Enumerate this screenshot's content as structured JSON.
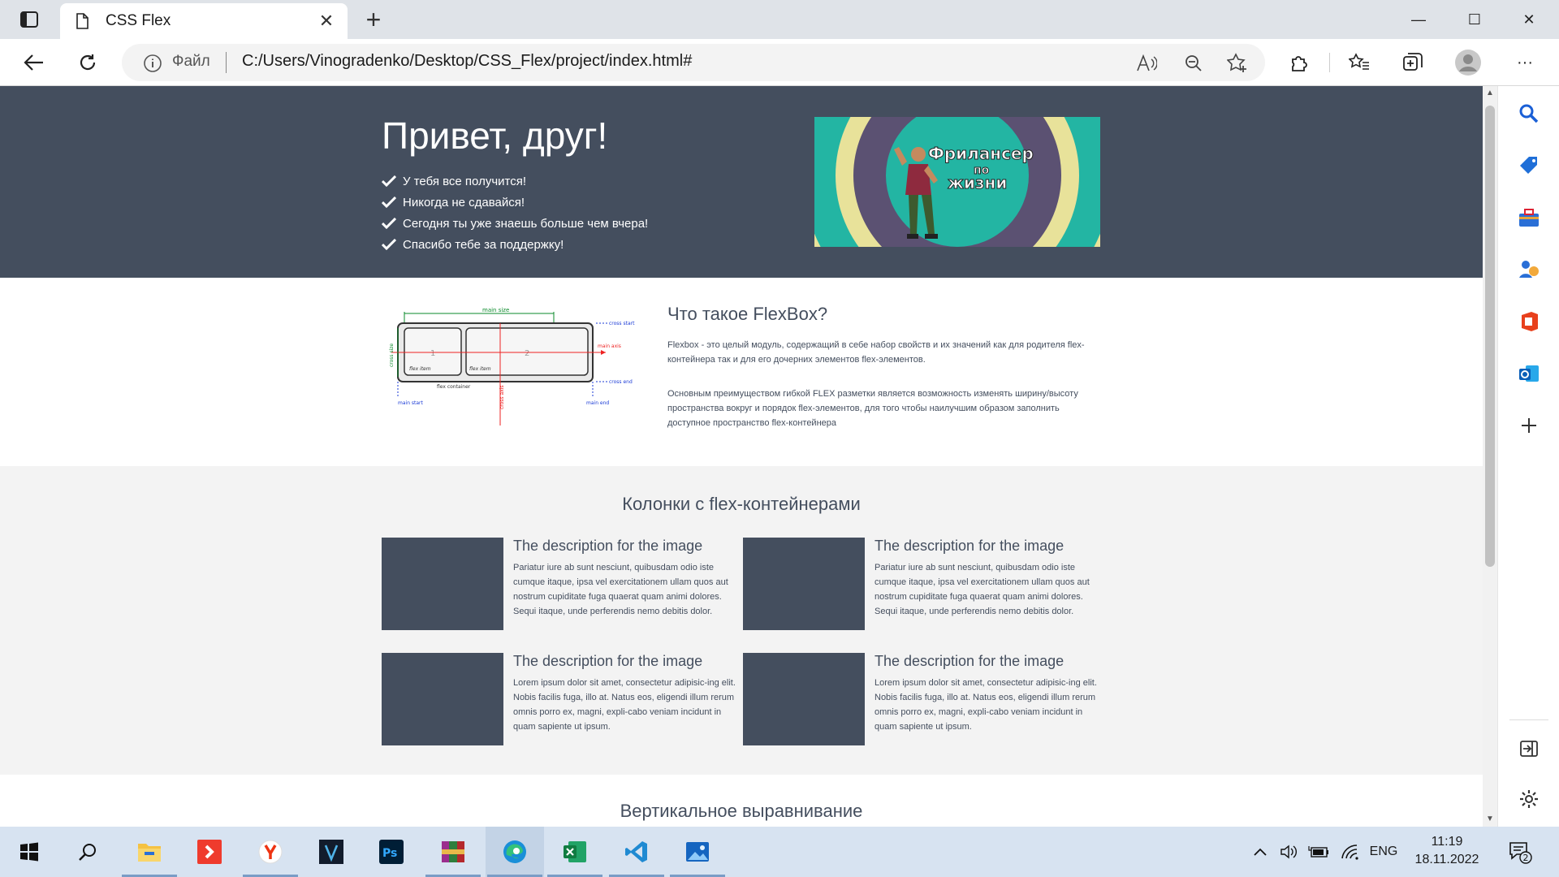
{
  "browser": {
    "tab_title": "CSS Flex",
    "tab_close": "✕",
    "new_tab": "+",
    "address": {
      "file_label": "Файл",
      "url": "C:/Users/Vinogradenko/Desktop/CSS_Flex/project/index.html#"
    },
    "window_controls": [
      "—",
      "☐",
      "✕"
    ],
    "menu": "···"
  },
  "page": {
    "hero": {
      "title": "Привет, друг!",
      "items": [
        "У тебя все получится!",
        "Никогда не сдавайся!",
        "Сегодня ты уже знаешь больше чем вчера!",
        "Спасибо тебе за поддержку!"
      ],
      "banner_text": [
        "Фрилансер",
        "по",
        "жизни"
      ]
    },
    "about": {
      "diagram_labels": {
        "main_size": "main size",
        "cross_start": "cross start",
        "main_axis": "main axis",
        "cross_end": "cross end",
        "cross_size": "cross size",
        "cross_axis": "cross axis",
        "flex_item": "flex item",
        "flex_container": "flex container",
        "main_start": "main start",
        "main_end": "main end",
        "n1": "1",
        "n2": "2"
      },
      "title": "Что такое FlexBox?",
      "p1": "Flexbox - это целый модуль, содержащий в себе набор свойств и их значений как для родителя flex-контейнера так и для его дочерних элементов flex-элементов.",
      "p2": "Основным преимуществом гибкой FLEX разметки является возможность изменять ширину/высоту пространства вокруг и порядок flex-элементов, для того чтобы наилучшим образом заполнить доступное пространство flex-контейнера"
    },
    "columns": {
      "title": "Колонки с flex-контейнерами",
      "cards": [
        {
          "title": "The description for the image",
          "text": "Pariatur iure ab sunt nesciunt, quibusdam odio iste cumque itaque, ipsa vel exercitationem ullam quos aut nostrum cupiditate fuga quaerat quam animi dolores. Sequi itaque, unde perferendis nemo debitis dolor."
        },
        {
          "title": "The description for the image",
          "text": "Pariatur iure ab sunt nesciunt, quibusdam odio iste cumque itaque, ipsa vel exercitationem ullam quos aut nostrum cupiditate fuga quaerat quam animi dolores. Sequi itaque, unde perferendis nemo debitis dolor."
        },
        {
          "title": "The description for the image",
          "text": "Lorem ipsum dolor sit amet, consectetur adipisic-ing elit. Nobis facilis fuga, illo at. Natus eos, eligendi illum rerum omnis porro ex, magni, expli-cabo veniam incidunt in quam sapiente ut ipsum."
        },
        {
          "title": "The description for the image",
          "text": "Lorem ipsum dolor sit amet, consectetur adipisic-ing elit. Nobis facilis fuga, illo at. Natus eos, eligendi illum rerum omnis porro ex, magni, expli-cabo veniam incidunt in quam sapiente ut ipsum."
        }
      ]
    },
    "vertical": {
      "title": "Вертикальное выравнивание"
    }
  },
  "taskbar": {
    "lang": "ENG",
    "time": "11:19",
    "date": "18.11.2022",
    "notifications": "2"
  },
  "colors": {
    "hero_bg": "#444e5e",
    "section_bg": "#f3f3f3",
    "taskbar_bg": "#d7e3f1"
  }
}
